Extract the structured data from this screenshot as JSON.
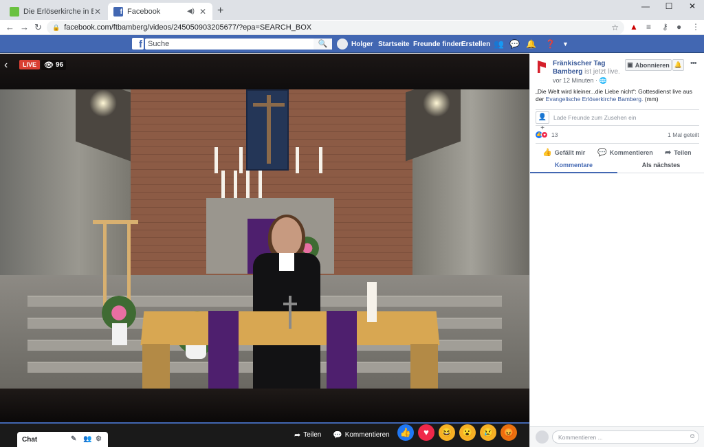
{
  "browser": {
    "tabs": [
      {
        "title": "Die Erlöserkirche in Bamberg ist",
        "favicon_color": "#6ac13f"
      },
      {
        "title": "Facebook",
        "favicon_color": "#4267b2"
      }
    ],
    "url": "facebook.com/ftbamberg/videos/245050903205677/?epa=SEARCH_BOX",
    "new_tab_symbol": "+",
    "window_buttons": [
      "—",
      "☐",
      "✕"
    ]
  },
  "fb_topbar": {
    "logo": "f",
    "search_placeholder": "Suche",
    "user": "Holger",
    "links": [
      "Startseite",
      "Freunde finden",
      "Erstellen"
    ],
    "icons": [
      "friends-icon",
      "messenger-icon",
      "notifications-icon",
      "help-icon",
      "dropdown-icon"
    ]
  },
  "video": {
    "live_label": "LIVE",
    "viewers": "96",
    "share_label": "Teilen",
    "comment_label": "Kommentieren",
    "reactions": [
      {
        "name": "like",
        "glyph": "👍",
        "color": "#2078f4"
      },
      {
        "name": "love",
        "glyph": "♥",
        "color": "#f0284a"
      },
      {
        "name": "haha",
        "glyph": "😆",
        "color": "#f7b125"
      },
      {
        "name": "wow",
        "glyph": "😮",
        "color": "#f7b125"
      },
      {
        "name": "sad",
        "glyph": "😢",
        "color": "#f7b125"
      },
      {
        "name": "angry",
        "glyph": "😡",
        "color": "#e9710f"
      }
    ]
  },
  "chat": {
    "label": "Chat"
  },
  "panel": {
    "page_name": "Fränkischer Tag Bamberg",
    "live_text": "ist jetzt live.",
    "posted": "vor 12 Minuten · ",
    "subscribe_label": "Abonnieren",
    "description_text": "„Die Welt wird kleiner...die Liebe nicht“: Gottesdienst live aus der ",
    "description_link": "Evangelische Erlöserkirche Bamberg.",
    "description_suffix": " (mm)",
    "invite_text": "Lade Freunde zum Zusehen ein",
    "reaction_count": "13",
    "shares": "1 Mal geteilt",
    "actions": {
      "like": "Gefällt mir",
      "comment": "Kommentieren",
      "share": "Teilen"
    },
    "tabs": {
      "comments": "Kommentare",
      "next": "Als nächstes"
    },
    "comment_placeholder": "Kommentieren ..."
  }
}
